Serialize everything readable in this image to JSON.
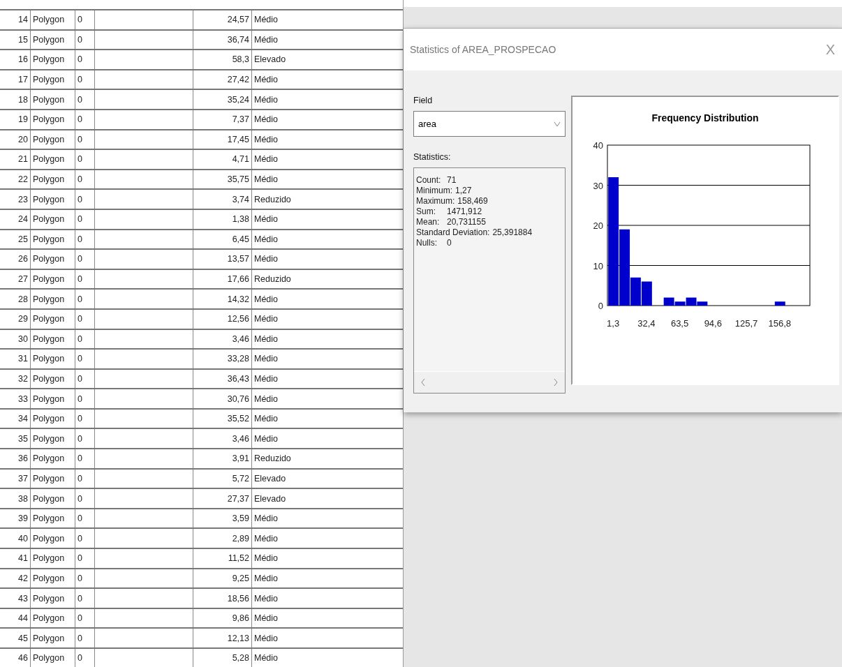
{
  "table": {
    "rows": [
      {
        "id": "14",
        "shape": "Polygon",
        "column_3": "0",
        "value": "24,57",
        "class": "Médio"
      },
      {
        "id": "15",
        "shape": "Polygon",
        "column_3": "0",
        "value": "36,74",
        "class": "Médio"
      },
      {
        "id": "16",
        "shape": "Polygon",
        "column_3": "0",
        "value": "58,3",
        "class": "Elevado"
      },
      {
        "id": "17",
        "shape": "Polygon",
        "column_3": "0",
        "value": "27,42",
        "class": "Médio"
      },
      {
        "id": "18",
        "shape": "Polygon",
        "column_3": "0",
        "value": "35,24",
        "class": "Médio"
      },
      {
        "id": "19",
        "shape": "Polygon",
        "column_3": "0",
        "value": "7,37",
        "class": "Médio"
      },
      {
        "id": "20",
        "shape": "Polygon",
        "column_3": "0",
        "value": "17,45",
        "class": "Médio"
      },
      {
        "id": "21",
        "shape": "Polygon",
        "column_3": "0",
        "value": "4,71",
        "class": "Médio"
      },
      {
        "id": "22",
        "shape": "Polygon",
        "column_3": "0",
        "value": "35,75",
        "class": "Médio"
      },
      {
        "id": "23",
        "shape": "Polygon",
        "column_3": "0",
        "value": "3,74",
        "class": "Reduzido"
      },
      {
        "id": "24",
        "shape": "Polygon",
        "column_3": "0",
        "value": "1,38",
        "class": "Médio"
      },
      {
        "id": "25",
        "shape": "Polygon",
        "column_3": "0",
        "value": "6,45",
        "class": "Médio"
      },
      {
        "id": "26",
        "shape": "Polygon",
        "column_3": "0",
        "value": "13,57",
        "class": "Médio"
      },
      {
        "id": "27",
        "shape": "Polygon",
        "column_3": "0",
        "value": "17,66",
        "class": "Reduzido"
      },
      {
        "id": "28",
        "shape": "Polygon",
        "column_3": "0",
        "value": "14,32",
        "class": "Médio"
      },
      {
        "id": "29",
        "shape": "Polygon",
        "column_3": "0",
        "value": "12,56",
        "class": "Médio"
      },
      {
        "id": "30",
        "shape": "Polygon",
        "column_3": "0",
        "value": "3,46",
        "class": "Médio"
      },
      {
        "id": "31",
        "shape": "Polygon",
        "column_3": "0",
        "value": "33,28",
        "class": "Médio"
      },
      {
        "id": "32",
        "shape": "Polygon",
        "column_3": "0",
        "value": "36,43",
        "class": "Médio"
      },
      {
        "id": "33",
        "shape": "Polygon",
        "column_3": "0",
        "value": "30,76",
        "class": "Médio"
      },
      {
        "id": "34",
        "shape": "Polygon",
        "column_3": "0",
        "value": "35,52",
        "class": "Médio"
      },
      {
        "id": "35",
        "shape": "Polygon",
        "column_3": "0",
        "value": "3,46",
        "class": "Médio"
      },
      {
        "id": "36",
        "shape": "Polygon",
        "column_3": "0",
        "value": "3,91",
        "class": "Reduzido"
      },
      {
        "id": "37",
        "shape": "Polygon",
        "column_3": "0",
        "value": "5,72",
        "class": "Elevado"
      },
      {
        "id": "38",
        "shape": "Polygon",
        "column_3": "0",
        "value": "27,37",
        "class": "Elevado"
      },
      {
        "id": "39",
        "shape": "Polygon",
        "column_3": "0",
        "value": "3,59",
        "class": "Médio"
      },
      {
        "id": "40",
        "shape": "Polygon",
        "column_3": "0",
        "value": "2,89",
        "class": "Médio"
      },
      {
        "id": "41",
        "shape": "Polygon",
        "column_3": "0",
        "value": "11,52",
        "class": "Médio"
      },
      {
        "id": "42",
        "shape": "Polygon",
        "column_3": "0",
        "value": "9,25",
        "class": "Médio"
      },
      {
        "id": "43",
        "shape": "Polygon",
        "column_3": "0",
        "value": "18,56",
        "class": "Médio"
      },
      {
        "id": "44",
        "shape": "Polygon",
        "column_3": "0",
        "value": "9,86",
        "class": "Médio"
      },
      {
        "id": "45",
        "shape": "Polygon",
        "column_3": "0",
        "value": "12,13",
        "class": "Médio"
      },
      {
        "id": "46",
        "shape": "Polygon",
        "column_3": "0",
        "value": "5,28",
        "class": "Médio"
      }
    ]
  },
  "dialog": {
    "title": "Statistics of AREA_PROSPECAO",
    "close": "X",
    "field_label": "Field",
    "field_value": "area",
    "statistics_label": "Statistics:",
    "statistics": [
      {
        "label": "Count:",
        "value": "71"
      },
      {
        "label": "Minimum:",
        "value": "1,27"
      },
      {
        "label": "Maximum:",
        "value": "158,469"
      },
      {
        "label": "Sum:",
        "value": "1471,912"
      },
      {
        "label": "Mean:",
        "value": "20,731155"
      },
      {
        "label": "Standard Deviation:",
        "value": "25,391884"
      },
      {
        "label": "Nulls:",
        "value": "0"
      }
    ],
    "chart_data": {
      "type": "bar",
      "title": "Frequency Distribution",
      "x": [
        1.3,
        11.7,
        22.0,
        32.4,
        42.7,
        53.1,
        63.5,
        73.9,
        84.2,
        94.6,
        104.9,
        115.3,
        125.7,
        136.1,
        146.4,
        156.8
      ],
      "series": [
        {
          "color": "#0000cc",
          "values": [
            32,
            19,
            7,
            6,
            0,
            2,
            1,
            2,
            1,
            0,
            0,
            0,
            0,
            0,
            0,
            1
          ]
        }
      ],
      "xlim": [
        -4,
        185
      ],
      "ylim": [
        0,
        40
      ],
      "yticks": [
        0,
        10,
        20,
        30,
        40
      ],
      "grid": true,
      "xticks": [
        {
          "value": 1.3,
          "label": "1,3"
        },
        {
          "value": 32.4,
          "label": "32,4"
        },
        {
          "value": 63.5,
          "label": "63,5"
        },
        {
          "value": 94.6,
          "label": "94,6"
        },
        {
          "value": 125.7,
          "label": "125,7"
        },
        {
          "value": 156.8,
          "label": "156,8"
        }
      ]
    }
  }
}
